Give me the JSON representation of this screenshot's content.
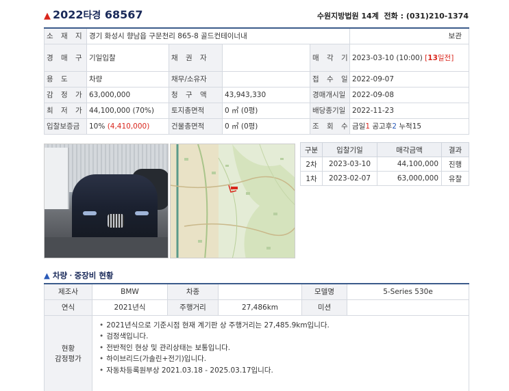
{
  "case": {
    "year": "2022",
    "type": "타경",
    "number": "68567",
    "court": "수원지방법원 14계",
    "phone_label": "전화 :",
    "phone": "(031)210-1374"
  },
  "info": {
    "location_label": "소 재 지",
    "location": "경기 화성시 향남읍 구문천리 865-8 골드컨테이너내",
    "storage": "보관",
    "auction_type_label": "경 매 구 분",
    "auction_type": "기일입찰",
    "creditor_label": "채 권 자",
    "creditor": "",
    "sale_date_label": "매 각 기 일",
    "sale_date": "2023-03-10 (10:00)",
    "days_left_open": "[",
    "days_left_num": "13",
    "days_left_text": "일전]",
    "usage_label": "용 도",
    "usage": "차량",
    "debtor_label": "채무/소유자",
    "debtor": "",
    "receipt_label": "접 수 일",
    "receipt_date": "2022-09-07",
    "appraisal_label": "감 정 가",
    "appraisal": "63,000,000",
    "claim_label": "청 구 액",
    "claim": "43,943,330",
    "start_label": "경매개시일",
    "start_date": "2022-09-08",
    "minimum_label": "최 저 가",
    "minimum": "44,100,000 (70%)",
    "land_area_label": "토지총면적",
    "land_area": "0 ㎡ (0평)",
    "deadline_label": "배당종기일",
    "deadline": "2022-11-23",
    "deposit_label": "입찰보증금",
    "deposit_pct": "10%",
    "deposit_amount": "(4,410,000)",
    "building_area_label": "건물총면적",
    "building_area": "0 ㎡ (0평)",
    "views_label": "조 회 수",
    "views_today_label": "금일",
    "views_today": "1",
    "views_after_label": "공고후",
    "views_after": "2",
    "views_total_label": "누적",
    "views_total": "15"
  },
  "bid_history": {
    "headers": [
      "구분",
      "입찰기일",
      "매각금액",
      "결과"
    ],
    "rows": [
      {
        "round": "2차",
        "date": "2023-03-10",
        "price": "44,100,000",
        "result": "진행"
      },
      {
        "round": "1차",
        "date": "2023-02-07",
        "price": "63,000,000",
        "result": "유찰"
      }
    ]
  },
  "vehicle": {
    "section_title": "차량ㆍ중장비 현황",
    "maker_label": "제조사",
    "maker": "BMW",
    "car_type_label": "차종",
    "car_type": "",
    "model_label": "모델명",
    "model": "5-Series 530e",
    "year_label": "연식",
    "year": "2021년식",
    "mileage_label": "주행거리",
    "mileage": "27,486km",
    "transmission_label": "미션",
    "transmission": "",
    "eval_label_1": "현황",
    "eval_label_2": "감정평가",
    "eval_lines": [
      "2021년식으로 기준시점 현재 계기판 상 주행거리는 27,485.9km입니다.",
      "검정색입니다.",
      "전반적인 현상 및 관리상태는 보통입니다.",
      "하이브리드(가솔린+전기)입니다.",
      "자동차등록원부상 2021.03.18 - 2025.03.17입니다."
    ]
  },
  "colors": {
    "accent_red": "#d9261c",
    "accent_blue": "#2a5ab8",
    "title_navy": "#1a2a5a"
  }
}
